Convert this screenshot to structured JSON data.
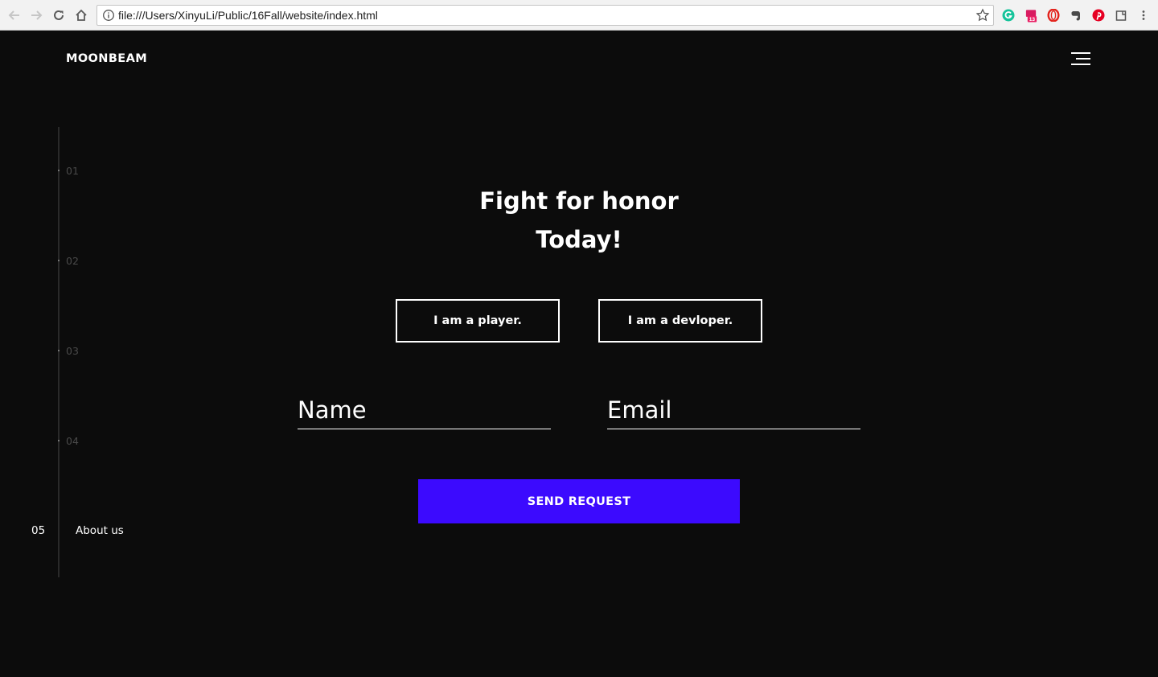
{
  "browser": {
    "url": "file:///Users/XinyuLi/Public/16Fall/website/index.html",
    "extensions": [
      {
        "icon": "grammarly-icon",
        "color": "#15c39a"
      },
      {
        "icon": "calendar-extension-icon",
        "color": "#e91e63",
        "badge": "13"
      },
      {
        "icon": "opera-icon",
        "color": "#e3231c"
      },
      {
        "icon": "evernote-icon",
        "color": "#4a4a4a"
      },
      {
        "icon": "pinterest-icon",
        "color": "#e60023"
      },
      {
        "icon": "window-icon",
        "color": "#555555"
      },
      {
        "icon": "kebab-menu-icon",
        "color": "#555555"
      }
    ]
  },
  "site": {
    "brand": "MOONBEAM",
    "menu_icon": "hamburger-menu-icon",
    "timeline": {
      "items": [
        "01",
        "02",
        "03",
        "04"
      ],
      "active": {
        "number": "05",
        "label": "About us"
      }
    },
    "headline": {
      "line1": "Fight for honor",
      "line2": "Today!"
    },
    "roles": {
      "player": "I am a player.",
      "developer": "I am a devloper."
    },
    "form": {
      "name_placeholder": "Name",
      "email_placeholder": "Email",
      "submit": "SEND REQUEST"
    },
    "accent_color": "#3c0afe",
    "background_color": "#0c0c0c"
  }
}
